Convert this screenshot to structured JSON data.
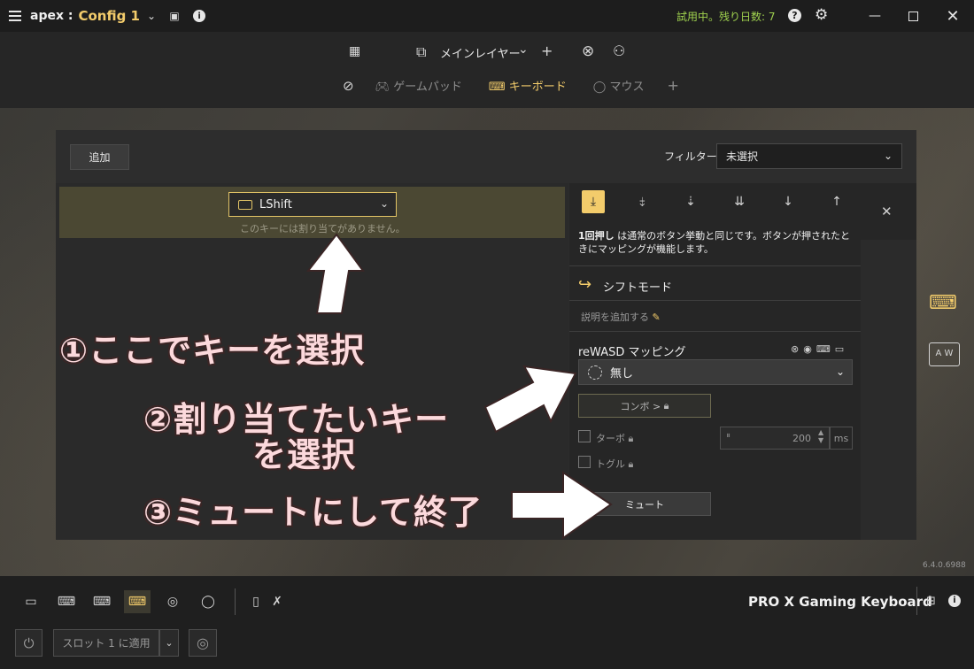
{
  "titlebar": {
    "app": "apex :",
    "config": "Config 1",
    "trial": "試用中。残り日数: 7",
    "help": "?"
  },
  "toolbar": {
    "layer": "メインレイヤー",
    "tabs": {
      "gamepad": "ゲームパッド",
      "keyboard": "キーボード",
      "mouse": "マウス"
    }
  },
  "panel": {
    "add_button": "追加",
    "filter_label": "フィルター:",
    "filter_value": "未選択",
    "selected_key": "LShift",
    "key_note": "このキーには割り当てがありません。",
    "description_bold": "1回押し",
    "description_rest": " は通常のボタン挙動と同じです。ボタンが押されたときにマッピングが機能します。",
    "shift_mode": "シフトモード",
    "add_description": "説明を追加する",
    "mapping_title": "reWASD マッピング",
    "mapping_value": "無し",
    "combo": "コンボ >",
    "turbo": "ターボ",
    "toggle": "トグル",
    "turbo_value": "200",
    "turbo_unit": "ms",
    "mute": "ミュート"
  },
  "annotations": {
    "step1": "①ここでキーを選択",
    "step2_line1": "②割り当てたいキー",
    "step2_line2": "を選択",
    "step3": "③ミュートにして終了"
  },
  "version": "6.4.0.6988",
  "bottom": {
    "device": "PRO X Gaming Keyboard",
    "slot": "スロット 1 に適用"
  }
}
